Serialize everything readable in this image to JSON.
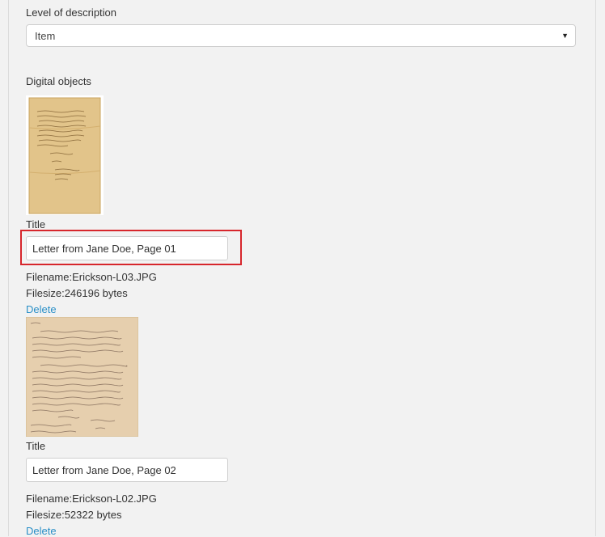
{
  "level_of_description": {
    "label": "Level of description",
    "selected": "Item"
  },
  "digital_objects": {
    "label": "Digital objects",
    "items": [
      {
        "title_label": "Title",
        "title_value": "Letter from Jane Doe, Page 01",
        "filename_label": "Filename:",
        "filename": "Erickson-L03.JPG",
        "filesize_label": "Filesize:",
        "filesize": "246196 bytes",
        "delete_label": "Delete"
      },
      {
        "title_label": "Title",
        "title_value": "Letter from Jane Doe, Page 02",
        "filename_label": "Filename:",
        "filename": "Erickson-L02.JPG",
        "filesize_label": "Filesize:",
        "filesize": "52322 bytes",
        "delete_label": "Delete"
      }
    ]
  },
  "colors": {
    "background": "#f2f2f2",
    "link": "#2a8fc7",
    "highlight": "#d7262c"
  }
}
